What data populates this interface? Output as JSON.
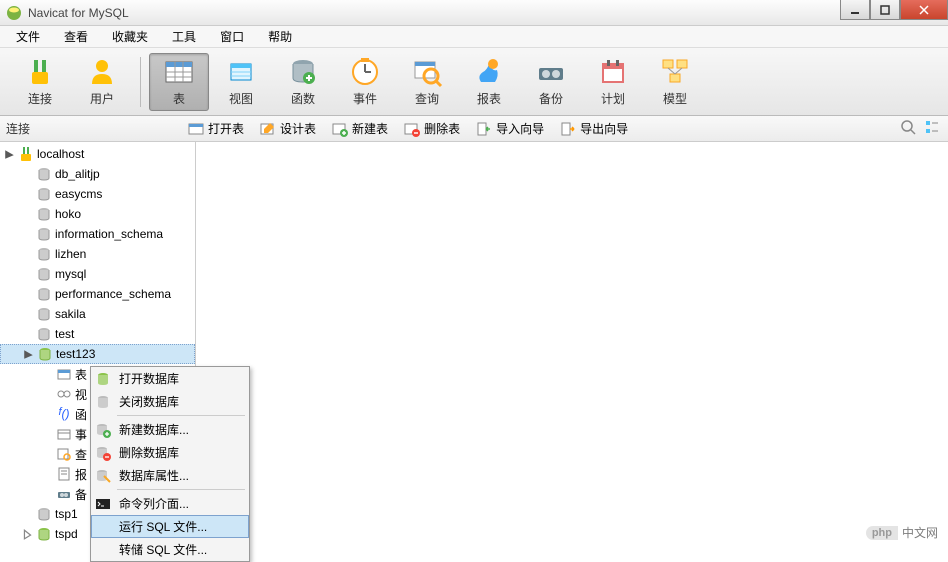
{
  "window": {
    "title": "Navicat for MySQL"
  },
  "menubar": [
    "文件",
    "查看",
    "收藏夹",
    "工具",
    "窗口",
    "帮助"
  ],
  "toolbar": [
    {
      "label": "连接",
      "icon": "connection"
    },
    {
      "label": "用户",
      "icon": "user"
    },
    {
      "label": "表",
      "icon": "table",
      "selected": true
    },
    {
      "label": "视图",
      "icon": "view"
    },
    {
      "label": "函数",
      "icon": "function"
    },
    {
      "label": "事件",
      "icon": "event"
    },
    {
      "label": "查询",
      "icon": "query"
    },
    {
      "label": "报表",
      "icon": "report"
    },
    {
      "label": "备份",
      "icon": "backup"
    },
    {
      "label": "计划",
      "icon": "schedule"
    },
    {
      "label": "模型",
      "icon": "model"
    }
  ],
  "subtoolbar": {
    "label": "连接",
    "actions": [
      {
        "label": "打开表",
        "icon": "open-table"
      },
      {
        "label": "设计表",
        "icon": "design-table"
      },
      {
        "label": "新建表",
        "icon": "new-table"
      },
      {
        "label": "删除表",
        "icon": "delete-table"
      },
      {
        "label": "导入向导",
        "icon": "import"
      },
      {
        "label": "导出向导",
        "icon": "export"
      }
    ]
  },
  "tree": {
    "host": "localhost",
    "dbs": [
      "db_alitjp",
      "easycms",
      "hoko",
      "information_schema",
      "lizhen",
      "mysql",
      "performance_schema",
      "sakila",
      "test"
    ],
    "selected_db": "test123",
    "sub_items": [
      {
        "label": "表",
        "icon": "folder-table"
      },
      {
        "label": "视",
        "icon": "folder-view"
      },
      {
        "label": "函",
        "icon": "folder-fx"
      },
      {
        "label": "事",
        "icon": "folder-event"
      },
      {
        "label": "查",
        "icon": "folder-query"
      },
      {
        "label": "报",
        "icon": "folder-report"
      },
      {
        "label": "备",
        "icon": "folder-backup"
      }
    ],
    "bottom_dbs": [
      "tsp1",
      "tspd"
    ]
  },
  "context_menu": [
    {
      "label": "打开数据库",
      "icon": "db-open"
    },
    {
      "label": "关闭数据库",
      "icon": "db-close"
    },
    {
      "sep": true
    },
    {
      "label": "新建数据库...",
      "icon": "db-new"
    },
    {
      "label": "删除数据库",
      "icon": "db-delete"
    },
    {
      "label": "数据库属性...",
      "icon": "db-props"
    },
    {
      "sep": true
    },
    {
      "label": "命令列介面...",
      "icon": "cli"
    },
    {
      "label": "运行 SQL 文件...",
      "icon": "run-sql",
      "hover": true
    },
    {
      "label": "转储 SQL 文件...",
      "icon": "dump-sql"
    }
  ],
  "watermark": {
    "badge": "php",
    "text": "中文网"
  }
}
